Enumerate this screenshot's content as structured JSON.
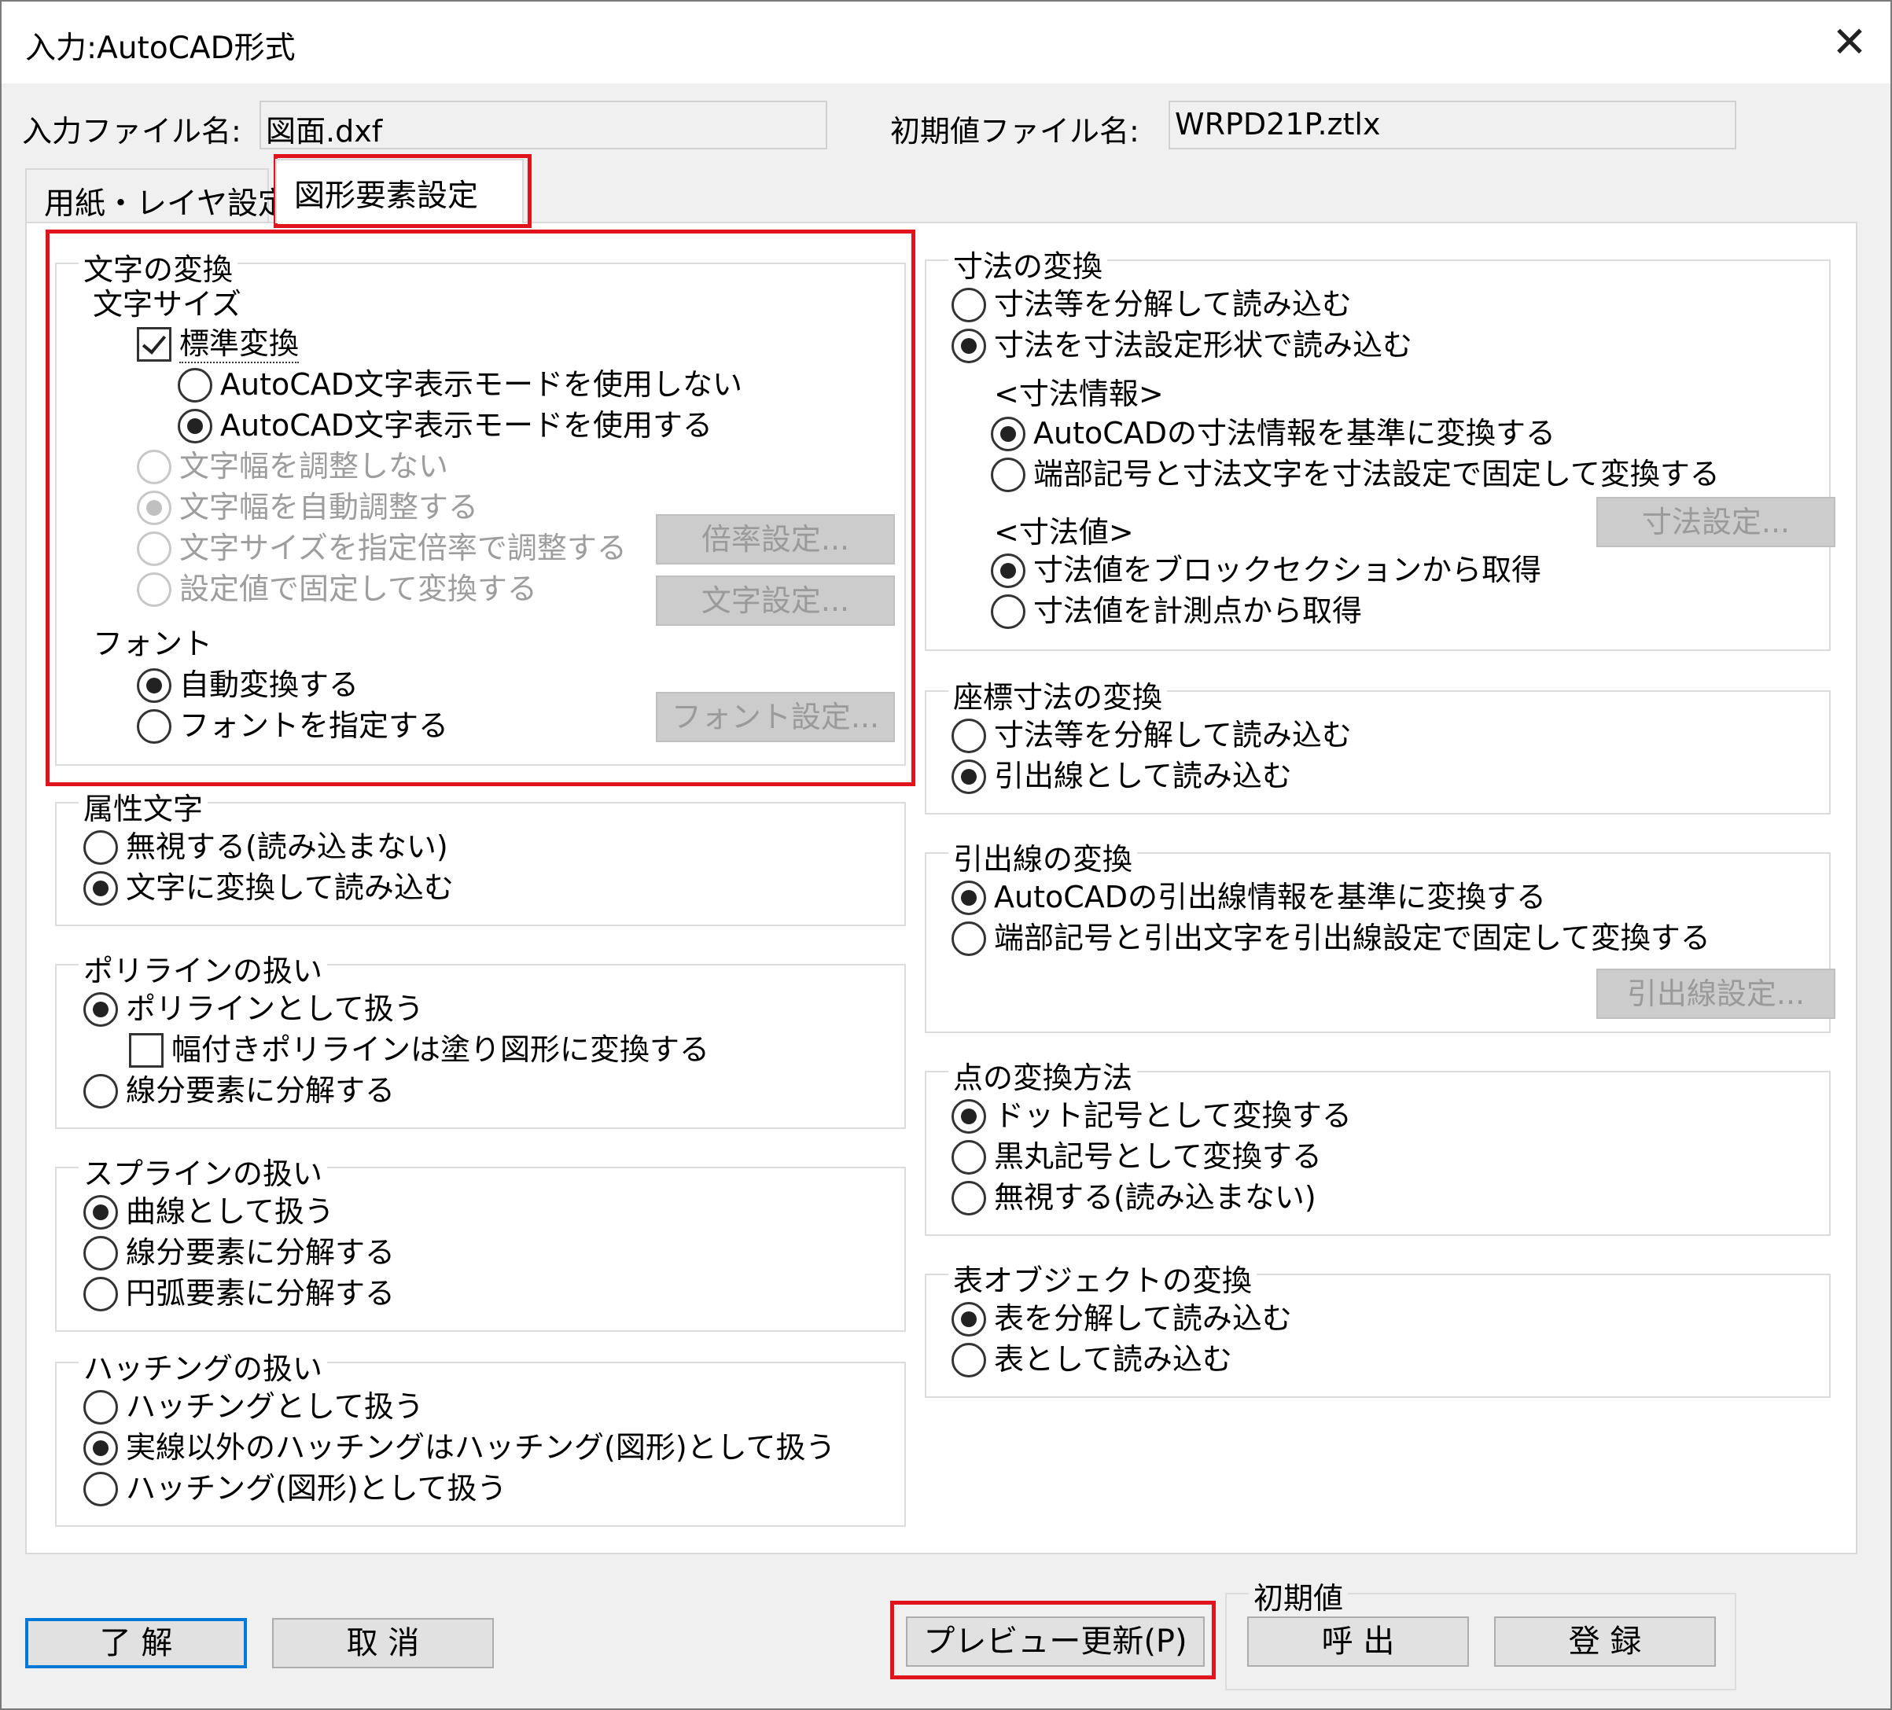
{
  "title": "入力:AutoCAD形式",
  "header": {
    "input_file_label": "入力ファイル名:",
    "input_file_value": "図面.dxf",
    "init_file_label": "初期値ファイル名:",
    "init_file_value": "WRPD21P.ztlx"
  },
  "tabs": [
    {
      "label": "用紙・レイヤ設定",
      "selected": false
    },
    {
      "label": "図形要素設定",
      "selected": true
    }
  ],
  "text_conversion": {
    "legend": "文字の変換",
    "size_label": "文字サイズ",
    "standard_convert": "標準変換",
    "autocad_mode_off": "AutoCAD文字表示モードを使用しない",
    "autocad_mode_on": "AutoCAD文字表示モードを使用する",
    "width_no_adjust": "文字幅を調整しない",
    "width_auto_adjust": "文字幅を自動調整する",
    "size_ratio": "文字サイズを指定倍率で調整する",
    "fixed_value": "設定値で固定して変換する",
    "ratio_button": "倍率設定...",
    "text_button": "文字設定...",
    "font_label": "フォント",
    "font_auto": "自動変換する",
    "font_specify": "フォントを指定する",
    "font_button": "フォント設定..."
  },
  "attribute_text": {
    "legend": "属性文字",
    "ignore": "無視する(読み込まない)",
    "convert": "文字に変換して読み込む"
  },
  "polyline": {
    "legend": "ポリラインの扱い",
    "as_polyline": "ポリラインとして扱う",
    "width_fill": "幅付きポリラインは塗り図形に変換する",
    "to_segments": "線分要素に分解する"
  },
  "spline": {
    "legend": "スプラインの扱い",
    "as_curve": "曲線として扱う",
    "to_segments": "線分要素に分解する",
    "to_arcs": "円弧要素に分解する"
  },
  "hatching": {
    "legend": "ハッチングの扱い",
    "as_hatching": "ハッチングとして扱う",
    "non_solid": "実線以外のハッチングはハッチング(図形)として扱う",
    "as_shape": "ハッチング(図形)として扱う"
  },
  "dimension": {
    "legend": "寸法の変換",
    "decompose": "寸法等を分解して読み込む",
    "as_dimension": "寸法を寸法設定形状で読み込む",
    "info_label": "<寸法情報>",
    "info_autocad": "AutoCADの寸法情報を基準に変換する",
    "info_fixed": "端部記号と寸法文字を寸法設定で固定して変換する",
    "value_label": "<寸法値>",
    "value_block": "寸法値をブロックセクションから取得",
    "value_measure": "寸法値を計測点から取得",
    "settings_button": "寸法設定..."
  },
  "coord_dimension": {
    "legend": "座標寸法の変換",
    "decompose": "寸法等を分解して読み込む",
    "as_leader": "引出線として読み込む"
  },
  "leader": {
    "legend": "引出線の変換",
    "autocad": "AutoCADの引出線情報を基準に変換する",
    "fixed": "端部記号と引出文字を引出線設定で固定して変換する",
    "settings_button": "引出線設定..."
  },
  "point": {
    "legend": "点の変換方法",
    "as_dot": "ドット記号として変換する",
    "as_black_circle": "黒丸記号として変換する",
    "ignore": "無視する(読み込まない)"
  },
  "table_object": {
    "legend": "表オブジェクトの変換",
    "decompose": "表を分解して読み込む",
    "as_table": "表として読み込む"
  },
  "footer": {
    "ok": "了 解",
    "cancel": "取 消",
    "preview": "プレビュー更新(P)",
    "defaults_label": "初期値",
    "load": "呼 出",
    "register": "登 録"
  },
  "colors": {
    "highlight_box": "#e0141c",
    "default_button_border": "#0078d7",
    "disabled_text": "#9d9d9d"
  }
}
